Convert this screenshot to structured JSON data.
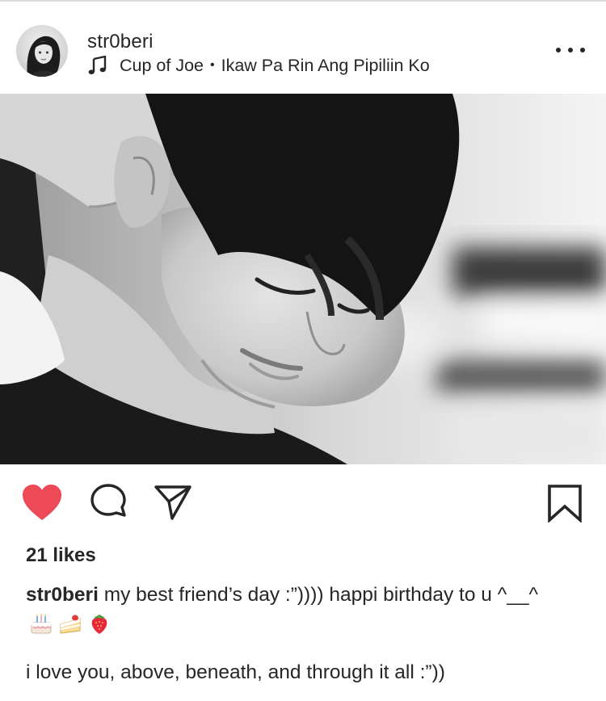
{
  "post": {
    "username": "str0beri",
    "music": {
      "artist": "Cup of Joe",
      "separator": "•",
      "song": "Ikaw Pa Rin Ang Pipiliin Ko"
    }
  },
  "actions": {
    "liked": true,
    "heart_color": "#ed4956"
  },
  "likes_text": "21 likes",
  "caption": {
    "username": "str0beri",
    "text": " my best friend’s day :”)))) happi birthday to u ^__^",
    "emojis": [
      "birthday-cake-icon",
      "shortcake-icon",
      "strawberry-icon"
    ],
    "second_paragraph": "i love you, above, beneath, and through it all :”))"
  },
  "colors": {
    "text": "#262626",
    "like_red": "#ed4956"
  }
}
